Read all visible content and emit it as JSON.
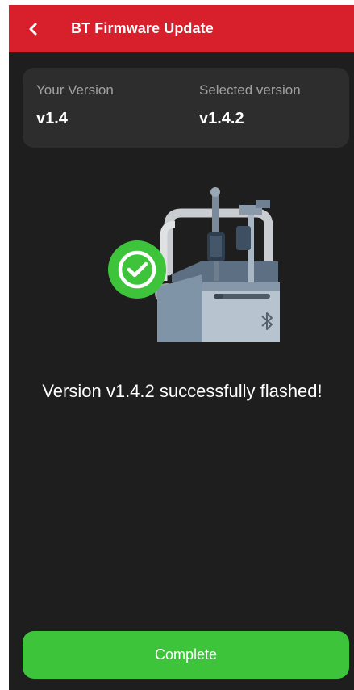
{
  "header": {
    "title": "BT Firmware Update",
    "back_icon": "chevron-left-icon",
    "background_color": "#d8202c"
  },
  "versions": {
    "current_label": "Your Version",
    "current_value": "v1.4",
    "selected_label": "Selected version",
    "selected_value": "v1.4.2"
  },
  "illustration": {
    "icons": [
      "success-check-icon",
      "bluetooth-icon",
      "firmware-device-illustration"
    ],
    "success_color": "#3dc43a"
  },
  "status": {
    "message": "Version v1.4.2 successfully flashed!"
  },
  "footer": {
    "complete_label": "Complete",
    "button_color": "#3dc43a"
  }
}
